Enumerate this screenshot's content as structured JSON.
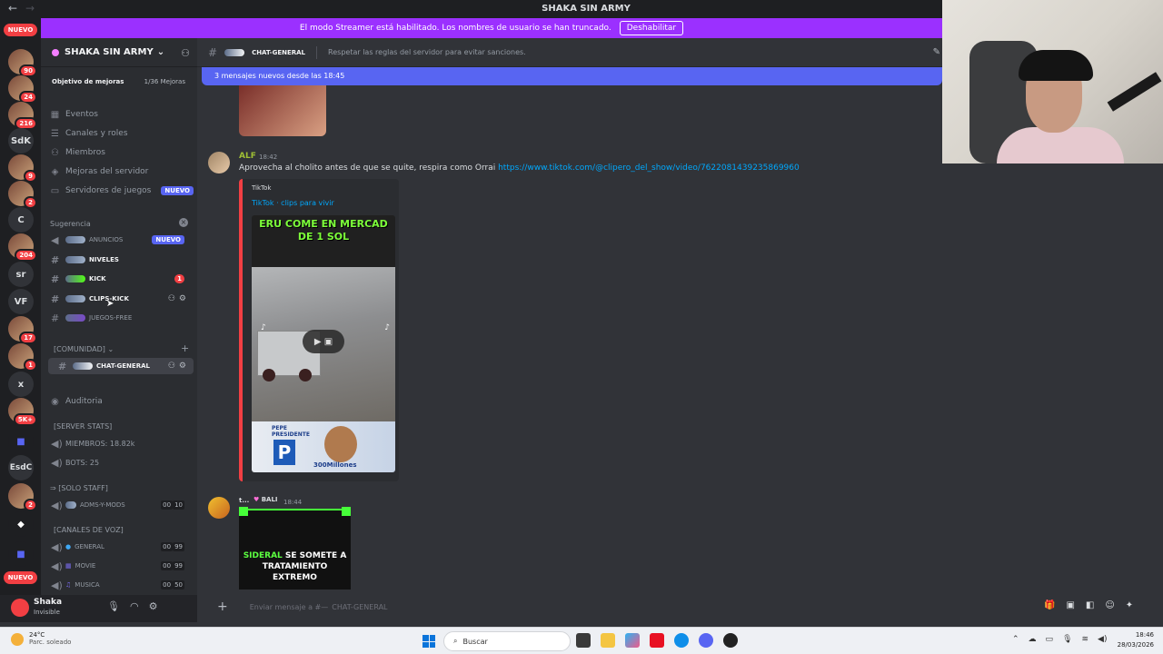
{
  "window": {
    "title": "SHAKA SIN ARMY"
  },
  "streamer_banner": {
    "text": "El modo Streamer está habilitado. Los nombres de usuario se han truncado.",
    "button": "Deshabilitar"
  },
  "servers": {
    "top_pill": "NUEVO",
    "bottom_pill": "NUEVO",
    "items": [
      {
        "label": "",
        "count": "90"
      },
      {
        "label": "",
        "count": "24"
      },
      {
        "label": "",
        "count": "216"
      },
      {
        "label": "SdK",
        "count": ""
      },
      {
        "label": "",
        "count": "9"
      },
      {
        "label": "",
        "count": "2"
      },
      {
        "label": "C",
        "count": ""
      },
      {
        "label": "",
        "count": "204"
      },
      {
        "label": "sr",
        "count": ""
      },
      {
        "label": "VF",
        "count": ""
      },
      {
        "label": "",
        "count": "17"
      },
      {
        "label": "",
        "count": "1"
      },
      {
        "label": "x",
        "count": ""
      },
      {
        "label": "",
        "count": "5K+"
      },
      {
        "label": "",
        "count": ""
      },
      {
        "label": "EsdC",
        "count": ""
      },
      {
        "label": "",
        "count": "2"
      },
      {
        "label": "",
        "count": ""
      },
      {
        "label": "",
        "count": ""
      }
    ]
  },
  "sidebar": {
    "server_name": "SHAKA SIN ARMY",
    "boost": {
      "label": "Objetivo de mejoras",
      "value": "1/36 Mejoras"
    },
    "nav": [
      {
        "label": "Eventos"
      },
      {
        "label": "Canales y roles"
      },
      {
        "label": "Miembros"
      },
      {
        "label": "Mejoras del servidor"
      },
      {
        "label": "Servidores de juegos",
        "badge": "NUEVO"
      }
    ],
    "suggestion_label": "Sugerencia",
    "channels": [
      {
        "name": "ANUNCIOS",
        "badge": "NUEVO"
      },
      {
        "name": "NIVELES"
      },
      {
        "name": "KICK",
        "unread": "1"
      },
      {
        "name": "CLIPS-KICK"
      },
      {
        "name": "JUEGOS-FREE"
      }
    ],
    "comunidad": "[COMUNIDAD]",
    "chat_general": "CHAT-GENERAL",
    "auditoria": "Auditoria",
    "server_stats": "[SERVER STATS]",
    "miembros": "MIEMBROS: 18.82k",
    "bots": "BOTS: 25",
    "solo_staff": "[SOLO STAFF]",
    "adms": {
      "name": "ADMS-Y-MODS",
      "a": "00",
      "b": "10"
    },
    "canales_voz": "[CANALES DE VOZ]",
    "voice": [
      {
        "name": "GENERAL",
        "a": "00",
        "b": "99"
      },
      {
        "name": "MOVIE",
        "a": "00",
        "b": "99"
      },
      {
        "name": "MUSICA",
        "a": "00",
        "b": "50"
      }
    ]
  },
  "user": {
    "name": "Shaka",
    "status": "Invisible"
  },
  "chat": {
    "channel": "CHAT-GENERAL",
    "topic": "Respetar las reglas del servidor para evitar sanciones.",
    "new_messages": "3 mensajes nuevos desde las 18:45",
    "msg1": {
      "author": "ALF",
      "time": "18:42",
      "text": "Aprovecha al cholito antes de que se quite, respira como Orrai",
      "link": "https://www.tiktok.com/@clipero_del_show/video/7622081439235869960",
      "embed_provider": "TikTok",
      "embed_title": "TikTok · clips para vivir",
      "video_caption_1": "ERU COME EN MERCAD",
      "video_caption_2": "DE 1 SOL",
      "video_bottom": "300Millones",
      "video_bottom_small": "PEPE PRESIDENTE"
    },
    "msg2": {
      "author": "t...",
      "tag": "BALI",
      "time": "18:44",
      "caption_green": "SIDERAL",
      "caption_rest": "SE SOMETE A TRATAMIENTO EXTREMO"
    },
    "composer_placeholder": "Enviar mensaje a #—",
    "composer_channel": "CHAT-GENERAL"
  },
  "taskbar": {
    "weather_temp": "24°C",
    "weather_desc": "Parc. soleado",
    "search": "Buscar",
    "time": "18:46",
    "date": "28/03/2026"
  },
  "colors": {
    "accent": "#5865f2",
    "streamer": "#9b30ff",
    "danger": "#f23f43",
    "link": "#00a8fc"
  }
}
